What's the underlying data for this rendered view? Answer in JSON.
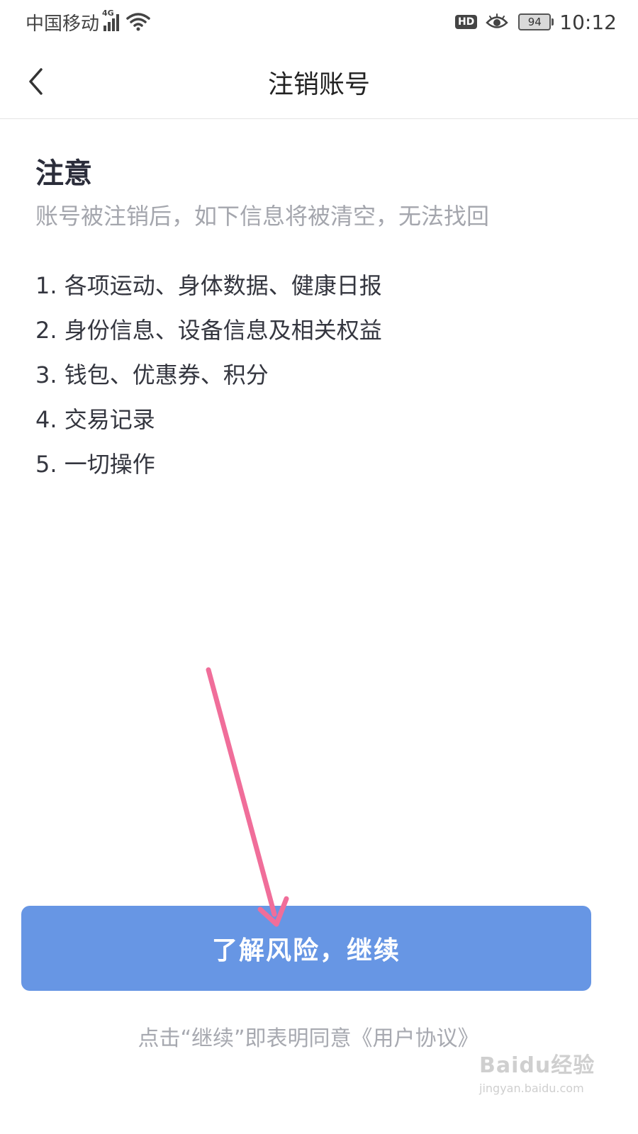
{
  "status_bar": {
    "carrier": "中国移动",
    "network_type": "4G",
    "hd_badge": "HD",
    "battery_level": "94",
    "time": "10:12",
    "icons": [
      "signal-icon",
      "wifi-icon",
      "hd-icon",
      "eye-icon",
      "battery-icon"
    ]
  },
  "nav": {
    "back_icon": "chevron-left-icon",
    "title": "注销账号"
  },
  "notice": {
    "title": "注意",
    "subtitle": "账号被注销后，如下信息将被清空，无法找回",
    "items": [
      "1. 各项运动、身体数据、健康日报",
      "2. 身份信息、设备信息及相关权益",
      "3. 钱包、优惠券、积分",
      "4. 交易记录",
      "5. 一切操作"
    ]
  },
  "continue_button": {
    "label": "了解风险，继续"
  },
  "agreement": {
    "prefix": "点击“继续”即表明同意",
    "link": "《用户协议》"
  },
  "watermark": {
    "main": "Baidu经验",
    "sub": "jingyan.baidu.com"
  },
  "colors": {
    "primary_button": "#6796e4",
    "annotation_arrow": "#f06e9a",
    "secondary_text": "#a4a6ad"
  }
}
